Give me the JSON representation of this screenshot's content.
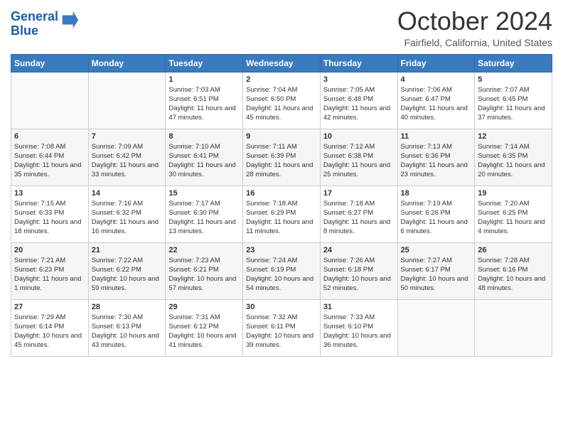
{
  "logo": {
    "line1": "General",
    "line2": "Blue",
    "arrow_color": "#3a7abf"
  },
  "title": "October 2024",
  "location": "Fairfield, California, United States",
  "days_of_week": [
    "Sunday",
    "Monday",
    "Tuesday",
    "Wednesday",
    "Thursday",
    "Friday",
    "Saturday"
  ],
  "weeks": [
    [
      {
        "day": "",
        "info": ""
      },
      {
        "day": "",
        "info": ""
      },
      {
        "day": "1",
        "info": "Sunrise: 7:03 AM\nSunset: 6:51 PM\nDaylight: 11 hours and 47 minutes."
      },
      {
        "day": "2",
        "info": "Sunrise: 7:04 AM\nSunset: 6:50 PM\nDaylight: 11 hours and 45 minutes."
      },
      {
        "day": "3",
        "info": "Sunrise: 7:05 AM\nSunset: 6:48 PM\nDaylight: 11 hours and 42 minutes."
      },
      {
        "day": "4",
        "info": "Sunrise: 7:06 AM\nSunset: 6:47 PM\nDaylight: 11 hours and 40 minutes."
      },
      {
        "day": "5",
        "info": "Sunrise: 7:07 AM\nSunset: 6:45 PM\nDaylight: 11 hours and 37 minutes."
      }
    ],
    [
      {
        "day": "6",
        "info": "Sunrise: 7:08 AM\nSunset: 6:44 PM\nDaylight: 11 hours and 35 minutes."
      },
      {
        "day": "7",
        "info": "Sunrise: 7:09 AM\nSunset: 6:42 PM\nDaylight: 11 hours and 33 minutes."
      },
      {
        "day": "8",
        "info": "Sunrise: 7:10 AM\nSunset: 6:41 PM\nDaylight: 11 hours and 30 minutes."
      },
      {
        "day": "9",
        "info": "Sunrise: 7:11 AM\nSunset: 6:39 PM\nDaylight: 11 hours and 28 minutes."
      },
      {
        "day": "10",
        "info": "Sunrise: 7:12 AM\nSunset: 6:38 PM\nDaylight: 11 hours and 25 minutes."
      },
      {
        "day": "11",
        "info": "Sunrise: 7:13 AM\nSunset: 6:36 PM\nDaylight: 11 hours and 23 minutes."
      },
      {
        "day": "12",
        "info": "Sunrise: 7:14 AM\nSunset: 6:35 PM\nDaylight: 11 hours and 20 minutes."
      }
    ],
    [
      {
        "day": "13",
        "info": "Sunrise: 7:15 AM\nSunset: 6:33 PM\nDaylight: 11 hours and 18 minutes."
      },
      {
        "day": "14",
        "info": "Sunrise: 7:16 AM\nSunset: 6:32 PM\nDaylight: 11 hours and 16 minutes."
      },
      {
        "day": "15",
        "info": "Sunrise: 7:17 AM\nSunset: 6:30 PM\nDaylight: 11 hours and 13 minutes."
      },
      {
        "day": "16",
        "info": "Sunrise: 7:18 AM\nSunset: 6:29 PM\nDaylight: 11 hours and 11 minutes."
      },
      {
        "day": "17",
        "info": "Sunrise: 7:18 AM\nSunset: 6:27 PM\nDaylight: 11 hours and 8 minutes."
      },
      {
        "day": "18",
        "info": "Sunrise: 7:19 AM\nSunset: 6:26 PM\nDaylight: 11 hours and 6 minutes."
      },
      {
        "day": "19",
        "info": "Sunrise: 7:20 AM\nSunset: 6:25 PM\nDaylight: 11 hours and 4 minutes."
      }
    ],
    [
      {
        "day": "20",
        "info": "Sunrise: 7:21 AM\nSunset: 6:23 PM\nDaylight: 11 hours and 1 minute."
      },
      {
        "day": "21",
        "info": "Sunrise: 7:22 AM\nSunset: 6:22 PM\nDaylight: 10 hours and 59 minutes."
      },
      {
        "day": "22",
        "info": "Sunrise: 7:23 AM\nSunset: 6:21 PM\nDaylight: 10 hours and 57 minutes."
      },
      {
        "day": "23",
        "info": "Sunrise: 7:24 AM\nSunset: 6:19 PM\nDaylight: 10 hours and 54 minutes."
      },
      {
        "day": "24",
        "info": "Sunrise: 7:26 AM\nSunset: 6:18 PM\nDaylight: 10 hours and 52 minutes."
      },
      {
        "day": "25",
        "info": "Sunrise: 7:27 AM\nSunset: 6:17 PM\nDaylight: 10 hours and 50 minutes."
      },
      {
        "day": "26",
        "info": "Sunrise: 7:28 AM\nSunset: 6:16 PM\nDaylight: 10 hours and 48 minutes."
      }
    ],
    [
      {
        "day": "27",
        "info": "Sunrise: 7:29 AM\nSunset: 6:14 PM\nDaylight: 10 hours and 45 minutes."
      },
      {
        "day": "28",
        "info": "Sunrise: 7:30 AM\nSunset: 6:13 PM\nDaylight: 10 hours and 43 minutes."
      },
      {
        "day": "29",
        "info": "Sunrise: 7:31 AM\nSunset: 6:12 PM\nDaylight: 10 hours and 41 minutes."
      },
      {
        "day": "30",
        "info": "Sunrise: 7:32 AM\nSunset: 6:11 PM\nDaylight: 10 hours and 39 minutes."
      },
      {
        "day": "31",
        "info": "Sunrise: 7:33 AM\nSunset: 6:10 PM\nDaylight: 10 hours and 36 minutes."
      },
      {
        "day": "",
        "info": ""
      },
      {
        "day": "",
        "info": ""
      }
    ]
  ]
}
